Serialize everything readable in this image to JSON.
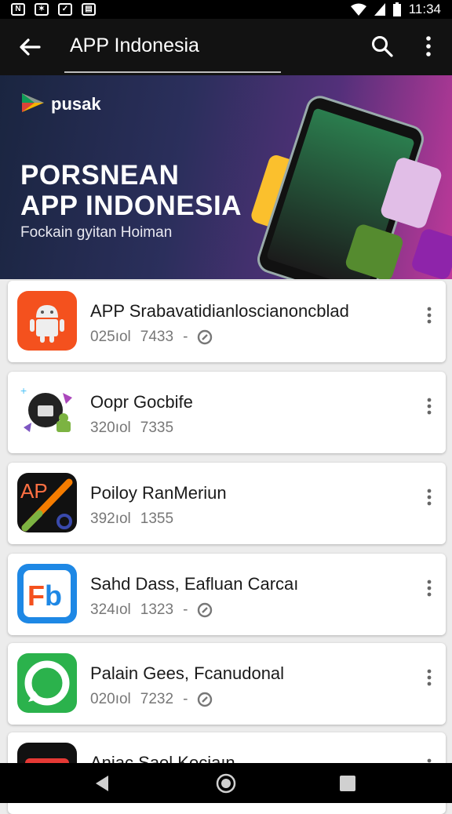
{
  "status_bar": {
    "time": "11:34"
  },
  "app_bar": {
    "title": "APP Indonesia"
  },
  "banner": {
    "brand": "pusak",
    "headline_line1": "PORSNEAN",
    "headline_line2": "APP INDONESIA",
    "subtitle": "Fockain gyitan Hoiman"
  },
  "apps": [
    {
      "name": "APP Srabavatidianloscianoncblad",
      "meta1": "025ıol",
      "meta2": "7433",
      "sep": "-",
      "icon": "android-robot-icon"
    },
    {
      "name": "Oopr Gocbife",
      "meta1": "320ıol",
      "meta2": "7335",
      "sep": "",
      "icon": "robot-collage-icon"
    },
    {
      "name": "Poiloy RanMeriun",
      "meta1": "392ıol",
      "meta2": "1355",
      "sep": "",
      "icon": "ap-pen-icon"
    },
    {
      "name": "Sahd Dass, Eafluan Carcaı",
      "meta1": "324ıol",
      "meta2": "1323",
      "sep": "-",
      "icon": "fb-icon"
    },
    {
      "name": "Palain Gees, Fcanudonal",
      "meta1": "020ıol",
      "meta2": "7232",
      "sep": "-",
      "icon": "green-chat-icon"
    },
    {
      "name": "Aniac Saol Kociaın",
      "icon": "red-app-icon"
    }
  ]
}
